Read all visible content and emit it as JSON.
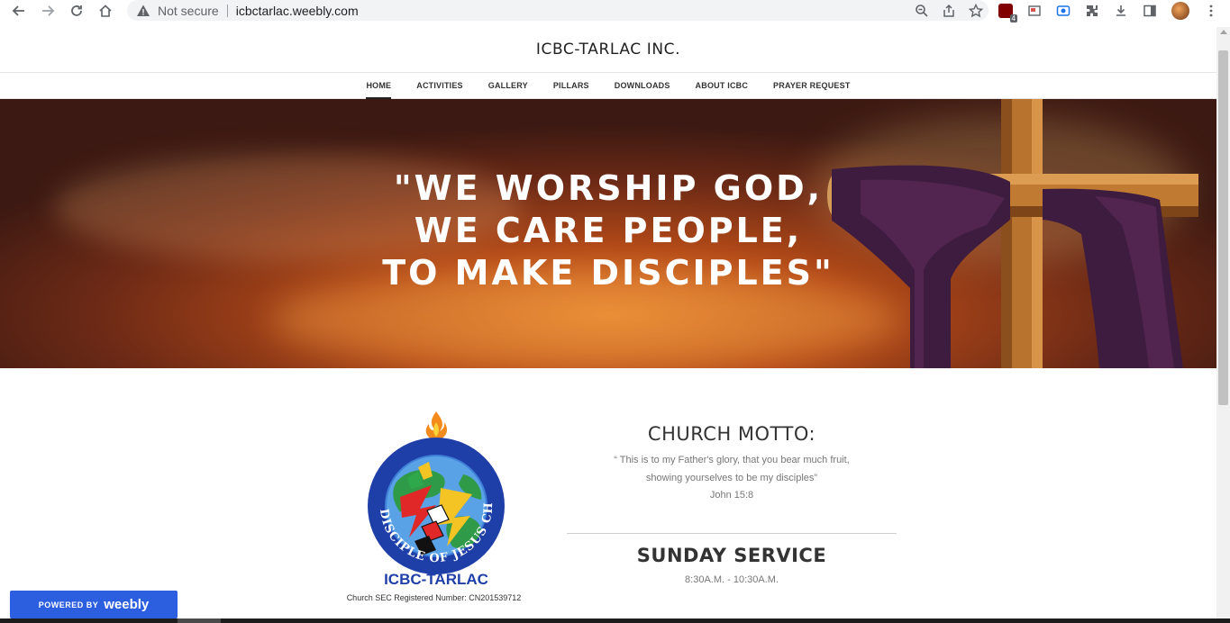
{
  "browser": {
    "security_label": "Not secure",
    "url": "icbctarlac.weebly.com",
    "extension_badge": "4"
  },
  "site": {
    "title": "ICBC-TARLAC INC.",
    "nav": [
      "HOME",
      "ACTIVITIES",
      "GALLERY",
      "PILLARS",
      "DOWNLOADS",
      "ABOUT ICBC",
      "PRAYER REQUEST"
    ],
    "active_nav": "HOME"
  },
  "hero": {
    "line1": "\"WE WORSHIP GOD,",
    "line2": "WE CARE PEOPLE,",
    "line3": "TO MAKE DISCIPLES\""
  },
  "logo": {
    "ring_text": "DISCIPLE OF JESUS CHRIST",
    "name": "ICBC-TARLAC"
  },
  "content": {
    "sec_number": "Church SEC Registered Number: CN201539712",
    "motto_heading": "CHURCH MOTTO:",
    "motto_line1": "“ This is to my Father's glory, that you bear much fruit,",
    "motto_line2": "showing yourselves to be my disciples”",
    "motto_ref": "John 15:8",
    "service_heading": "SUNDAY SERVICE",
    "service_time": "8:30A.M. - 10:30A.M."
  },
  "badge": {
    "powered_by": "POWERED BY",
    "brand": "weebly"
  },
  "colors": {
    "badge_blue": "#2b5fe0",
    "hero_orange": "#e07a2a"
  }
}
